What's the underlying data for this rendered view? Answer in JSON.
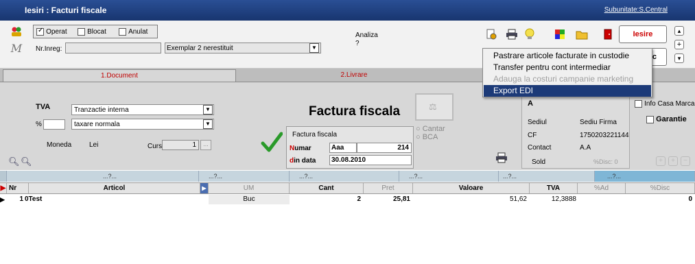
{
  "window": {
    "title": "Iesiri : Facturi fiscale",
    "subunitate": "Subunitate:S.Central"
  },
  "status_flags": {
    "operat_label": "Operat",
    "operat_checked": true,
    "blocat_label": "Blocat",
    "anulat_label": "Anulat"
  },
  "nrinreg": {
    "label": "Nr.Inreg:",
    "value": ""
  },
  "exemplar": {
    "value": "Exemplar 2 nerestituit"
  },
  "analiza": {
    "label": "Analiza",
    "value": "?"
  },
  "buttons": {
    "iesire": "Iesire",
    "partial": "ic",
    "plus": "+",
    "down": "▾",
    "up": "▴"
  },
  "tabs": [
    {
      "label": "1.Document",
      "active": true
    },
    {
      "label": "2.Livrare",
      "active": false
    }
  ],
  "tva": {
    "label": "TVA",
    "type_value": "Tranzactie interna",
    "pct_label": "%",
    "pct_value": "",
    "rate_value": "taxare normala"
  },
  "moneda": {
    "label": "Moneda",
    "value": "Lei",
    "curs_label": "Curs",
    "curs_value": "1",
    "curs_btn": "..."
  },
  "doc": {
    "title": "Factura fiscala",
    "box_title": "Factura fiscala",
    "numar_label_first": "N",
    "numar_label_rest": "umar",
    "numar_series": "Aaa",
    "numar_value": "214",
    "data_label_first": "d",
    "data_label_rest": "in data",
    "data_value": "30.08.2010",
    "cantar": "Cantar",
    "bca": "BCA"
  },
  "partner": {
    "name": "A",
    "sediul_label": "Sediul",
    "sediul_value": "Sediu Firma",
    "cf_label": "CF",
    "cf_value": "1750203221144",
    "contact_label": "Contact",
    "contact_value": "A.A",
    "sold_label": "Sold",
    "disc_label": "%Disc: 0",
    "info_casa": "Info Casa Marca",
    "garantie": "Garantie"
  },
  "filter_row": [
    "...?...",
    "...?...",
    "...?...",
    "...?...",
    "...?...",
    "...?..."
  ],
  "columns": {
    "nr": "Nr",
    "articol": "Articol",
    "um": "UM",
    "cant": "Cant",
    "pret": "Pret",
    "valoare": "Valoare",
    "tva": "TVA",
    "ad": "%Ad",
    "disc": "%Disc"
  },
  "rows": [
    {
      "nr": "1",
      "articol": "0Test",
      "um": "Buc",
      "cant": "2",
      "pret": "25,81",
      "valoare": "51,62",
      "tva": "12,3888",
      "ad": "",
      "disc": "0"
    }
  ],
  "context_menu": [
    {
      "label": "Pastrare articole facturate in custodie",
      "state": "normal"
    },
    {
      "label": "Transfer pentru cont intermediar",
      "state": "normal"
    },
    {
      "label": "Adauga la costuri campanie marketing",
      "state": "disabled"
    },
    {
      "label": "Export EDI",
      "state": "selected"
    }
  ],
  "colors": {
    "titlebar": "#1f3f80",
    "menu_selected": "#1c3a78",
    "header_row": "#c6d5de",
    "check_green": "#2a9a2a",
    "accent_red": "#cc0000"
  }
}
